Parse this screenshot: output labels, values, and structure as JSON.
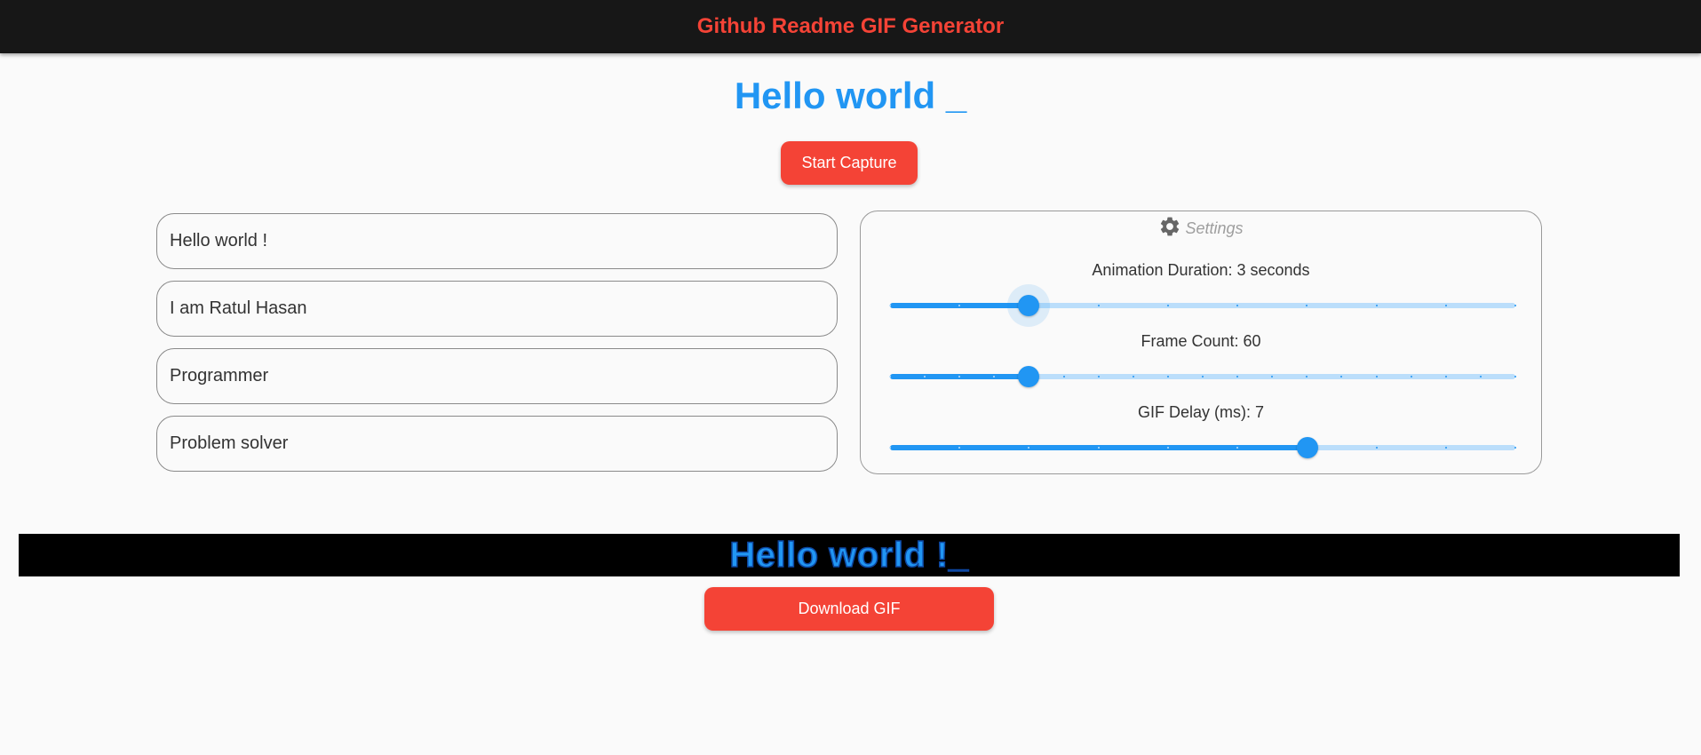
{
  "appbar": {
    "title": "Github Readme GIF Generator"
  },
  "preview": {
    "text": "Hello world _"
  },
  "buttons": {
    "start_capture": "Start Capture",
    "download_gif": "Download GIF"
  },
  "text_lines": [
    "Hello world !",
    "I am Ratul Hasan",
    "Programmer",
    "Problem solver"
  ],
  "settings": {
    "title": "Settings",
    "icon": "gear-icon",
    "sliders": [
      {
        "label": "Animation Duration: 3 seconds",
        "fraction": 0.222,
        "divisions": 9,
        "focused": true
      },
      {
        "label": "Frame Count: 60",
        "fraction": 0.222,
        "divisions": 18,
        "focused": false
      },
      {
        "label": "GIF Delay (ms): 7",
        "fraction": 0.667,
        "divisions": 9,
        "focused": false
      }
    ]
  },
  "gif_preview": {
    "text": "Hello world !_"
  },
  "colors": {
    "accent": "#2196f3",
    "accent_light": "#bbdefb",
    "brand_red": "#f44336",
    "appbar_bg": "#171717"
  }
}
